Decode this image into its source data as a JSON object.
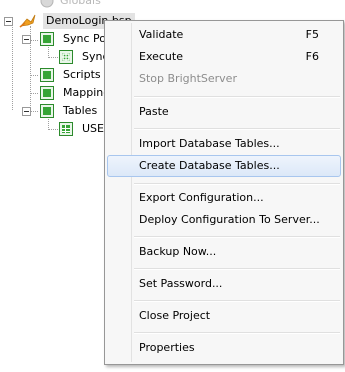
{
  "tree": {
    "top_partial": "Globals",
    "root": "DemoLogin.bsp",
    "sync_points": "Sync Poi",
    "sync_child": "Sync",
    "scripts": "Scripts",
    "mappings": "Mapping",
    "tables": "Tables",
    "users": "USER"
  },
  "menu": {
    "validate": {
      "label": "Validate",
      "shortcut": "F5"
    },
    "execute": {
      "label": "Execute",
      "shortcut": "F6"
    },
    "stop_server": {
      "label": "Stop BrightServer"
    },
    "paste": {
      "label": "Paste"
    },
    "import_tables": {
      "label": "Import Database Tables..."
    },
    "create_tables": {
      "label": "Create Database Tables..."
    },
    "export_config": {
      "label": "Export Configuration..."
    },
    "deploy_config": {
      "label": "Deploy Configuration To Server..."
    },
    "backup_now": {
      "label": "Backup Now..."
    },
    "set_password": {
      "label": "Set Password..."
    },
    "close_project": {
      "label": "Close Project"
    },
    "properties": {
      "label": "Properties"
    }
  },
  "icons": {
    "root_icon": "orange-bird-icon",
    "folder_icon": "green-folder-icon",
    "table_icon": "green-grid-icon"
  },
  "colors": {
    "menu_bg": "#f7f7f7",
    "hover_border": "#a8c6ee",
    "tree_green": "#36a536"
  }
}
